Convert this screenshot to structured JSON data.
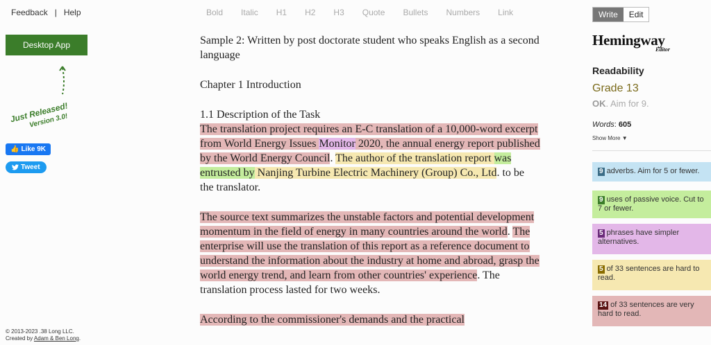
{
  "topnav": {
    "feedback": "Feedback",
    "separator": "|",
    "help": "Help"
  },
  "left": {
    "desktop_app": "Desktop App",
    "released_line1": "Just Released!",
    "released_line2": "Version 3.0!",
    "facebook_like": "Like 9K",
    "tweet": "Tweet",
    "copyright_line1": "© 2013-2023 .38 Long LLC.",
    "copyright_prefix": "Created by ",
    "copyright_authors": "Adam & Ben Long",
    "copyright_suffix": "."
  },
  "toolbar": [
    "Bold",
    "Italic",
    "H1",
    "H2",
    "H3",
    "Quote",
    "Bullets",
    "Numbers",
    "Link"
  ],
  "editor": {
    "p1": "Sample 2: Written by post doctorate student who speaks English as a second language",
    "p2": "Chapter 1 Introduction",
    "p3_heading": "1.1 Description of the Task",
    "p3_s1a": "The translation project requires an E-C translation of a 10,000-word excerpt from World Energy Issues ",
    "p3_s1_simpler": "Monitor",
    "p3_s1b": " 2020, the annual energy report published by the World Energy Council",
    "p3_dot1": ". ",
    "p3_s2a": "The author of the translation report ",
    "p3_s2_passive": "was entrusted by",
    "p3_s2b": " Nanjing Turbine Electric Machinery (Group) Co., Ltd",
    "p3_s2_end": ". to be the translator.",
    "p4_s1": "The source text summarizes the unstable factors and potential development momentum in the field of energy in many countries around the world",
    "p4_dot1": ". ",
    "p4_s2": "The enterprise will use the translation of this report as a reference document to understand the information about the industry at home and abroad, grasp the world energy trend, and learn from other countries' experience",
    "p4_s2_end": ". The translation process lasted for two weeks.",
    "p5": "According to the commissioner's demands and the practical"
  },
  "right": {
    "mode_write": "Write",
    "mode_edit": "Edit",
    "logo": "Hemingway",
    "logo_sub": "Editor",
    "readability": "Readability",
    "grade": "Grade 13",
    "aim_ok": "OK",
    "aim_text": ". Aim for 9.",
    "words_label": "Words",
    "words_value": "605",
    "show_more": "Show More",
    "cards": {
      "adverbs": {
        "count": "9",
        "text": "adverbs. Aim for 5 or fewer."
      },
      "passive": {
        "count": "9",
        "text": "uses of passive voice. Cut to 7 or fewer."
      },
      "simpler": {
        "count": "5",
        "text": "phrases have simpler alternatives."
      },
      "hard": {
        "count": "5",
        "text": "of 33 sentences are hard to read."
      },
      "very_hard": {
        "count": "14",
        "text": "of 33 sentences are very hard to read."
      }
    }
  }
}
